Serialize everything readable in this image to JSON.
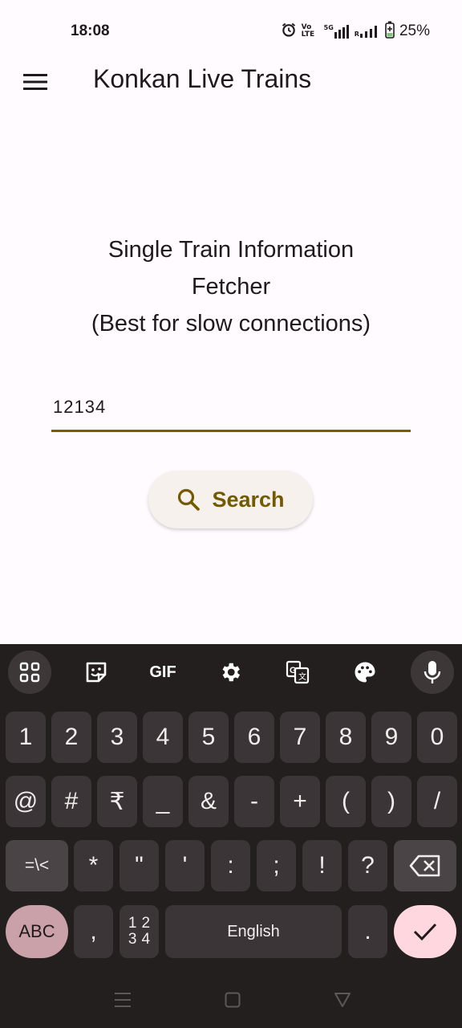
{
  "status": {
    "time": "18:08",
    "volte": "Vo LTE",
    "network": "5G",
    "roaming": "R",
    "battery": "25%"
  },
  "app_bar": {
    "title": "Konkan Live Trains",
    "menu_icon": "menu-icon"
  },
  "main": {
    "heading_line1": "Single Train Information",
    "heading_line2": "Fetcher",
    "heading_line3": "(Best for slow connections)",
    "train_number": "12134",
    "search_label": "Search",
    "accent_color": "#7b5e00"
  },
  "keyboard": {
    "toolbar": [
      "apps-grid-icon",
      "sticker-icon",
      "GIF",
      "settings-icon",
      "translate-icon",
      "palette-icon",
      "mic-icon"
    ],
    "gif_label": "GIF",
    "row1": [
      "1",
      "2",
      "3",
      "4",
      "5",
      "6",
      "7",
      "8",
      "9",
      "0"
    ],
    "row2": [
      "@",
      "#",
      "₹",
      "_",
      "&",
      "-",
      "+",
      "(",
      ")",
      "/"
    ],
    "row3": [
      "=\\<",
      "*",
      "\"",
      "'",
      ":",
      ";",
      "!",
      "?"
    ],
    "abc_label": "ABC",
    "comma_label": ",",
    "numsym_top": "12",
    "numsym_bottom": "34",
    "space_label": "English",
    "period_label": ".",
    "backspace_icon": "backspace-icon",
    "enter_icon": "check-icon"
  },
  "nav": [
    "recents-icon",
    "home-icon",
    "back-icon"
  ]
}
